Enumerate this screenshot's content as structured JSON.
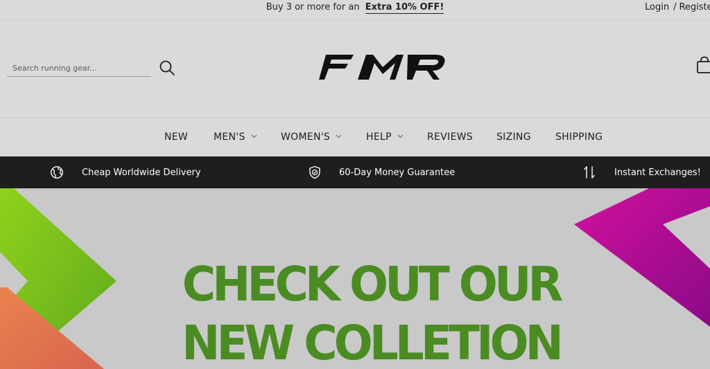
{
  "announcement": {
    "text": "Buy 3 or more for an",
    "promo": "Extra 10% OFF!"
  },
  "account": {
    "login": "Login",
    "separator": "/",
    "register": "Register"
  },
  "header": {
    "search_placeholder": "Search running gear...",
    "logo_text": "FMR"
  },
  "nav": {
    "items": [
      {
        "label": "NEW",
        "dropdown": false
      },
      {
        "label": "MEN'S",
        "dropdown": true
      },
      {
        "label": "WOMEN'S",
        "dropdown": true
      },
      {
        "label": "HELP",
        "dropdown": true
      },
      {
        "label": "REVIEWS",
        "dropdown": false
      },
      {
        "label": "SIZING",
        "dropdown": false
      },
      {
        "label": "SHIPPING",
        "dropdown": false
      }
    ]
  },
  "trust_bar": {
    "items": [
      {
        "icon": "globe-icon",
        "label": "Cheap Worldwide Delivery"
      },
      {
        "icon": "shield-check-icon",
        "label": "60-Day Money Guarantee"
      },
      {
        "icon": "exchange-arrows-icon",
        "label": "Instant Exchanges!"
      }
    ]
  },
  "hero": {
    "line1": "CHECK OUT OUR",
    "line2": "NEW COLLETION",
    "colors": {
      "text": "#4a8c22",
      "green": "#72c21c",
      "orange": "#e0704e",
      "magenta": "#cc0f9c"
    }
  }
}
